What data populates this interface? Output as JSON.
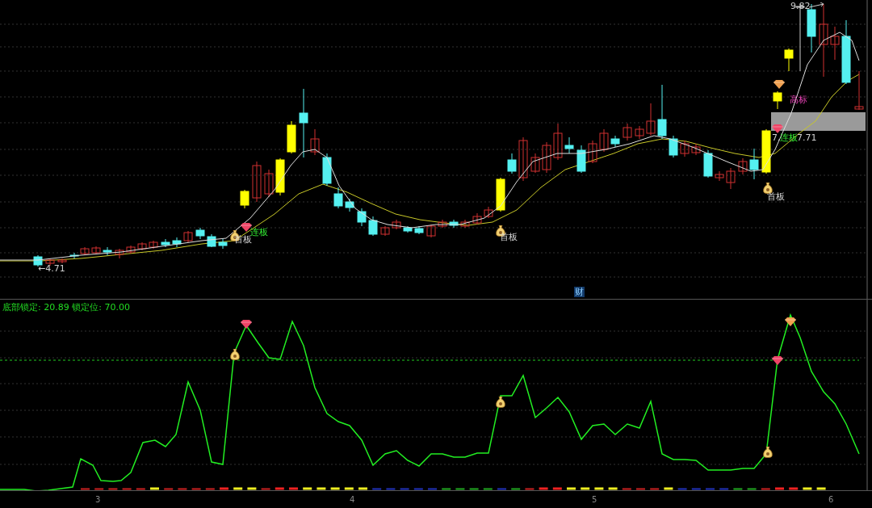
{
  "price_panel": {
    "low_label": "←4.71",
    "high_label": "9.82",
    "labels": [
      {
        "kind": "first",
        "text": "首板"
      },
      {
        "kind": "streak",
        "text": "连板"
      },
      {
        "kind": "first",
        "text": "首板"
      },
      {
        "kind": "first",
        "text": "首板"
      },
      {
        "kind": "value",
        "text": "7."
      },
      {
        "kind": "streak",
        "text": "连板"
      },
      {
        "kind": "value",
        "text": "7.71"
      },
      {
        "kind": "top",
        "text": "高标"
      }
    ],
    "finance_badge": "财"
  },
  "indicator_panel": {
    "legend": "底部锁定: 20.89 锁定位: 70.00"
  },
  "x_axis": {
    "ticks": [
      "3",
      "4",
      "5",
      "6"
    ]
  }
}
